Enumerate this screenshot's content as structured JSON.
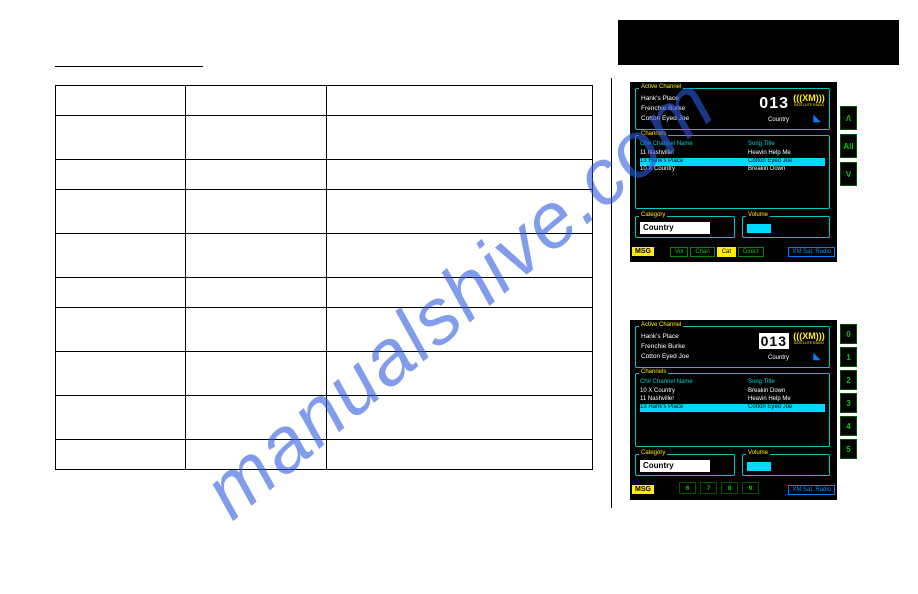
{
  "watermark": "manualshive.com",
  "fig1": {
    "active": {
      "label": "Active Channel",
      "name": "Hank's Place",
      "artist": "Frenchie Burke",
      "song": "Cotton Eyed Joe",
      "number": "013",
      "genre": "Country",
      "xm_mark": "(((XM)))",
      "xm_sub": "SATELLITE RADIO"
    },
    "channels": {
      "label": "Channels",
      "hdr_left": "Ch# Channel Name",
      "hdr_right": "Song Title",
      "rows": [
        {
          "n": "11  Nashville!",
          "t": "Heavin Help Me",
          "hl": false
        },
        {
          "n": "13  Hank's Place",
          "t": "Cotton Eyed Joe",
          "hl": true
        },
        {
          "n": "10  X Country",
          "t": "Breakin Down",
          "hl": false
        }
      ]
    },
    "category": {
      "label": "Category",
      "value": "Country"
    },
    "volume": {
      "label": "Volume"
    },
    "msg": "MSG",
    "buttons": [
      "Vol",
      "Chan",
      "Cat",
      "Direct"
    ],
    "active_btn": "Cat",
    "sat_radio": "XM Sat. Radio",
    "side": [
      "Ʌ",
      "All",
      "V"
    ]
  },
  "fig2": {
    "active": {
      "label": "Active Channel",
      "name": "Hank's Place",
      "artist": "Frenchie Burke",
      "song": "Cotton Eyed Joe",
      "number": "013",
      "genre": "Country",
      "xm_mark": "(((XM)))",
      "xm_sub": "SATELLITE RADIO"
    },
    "channels": {
      "label": "Channels",
      "hdr_left": "Ch# Channel Name",
      "hdr_right": "Song Title",
      "rows": [
        {
          "n": "10  X Country",
          "t": "Breakin Down",
          "hl": false
        },
        {
          "n": "11  Nashville!",
          "t": "Heavin Help Me",
          "hl": false
        },
        {
          "n": "13  Hank's Place",
          "t": "Cotton Eyed Joe",
          "hl": true
        }
      ]
    },
    "category": {
      "label": "Category",
      "value": "Country"
    },
    "volume": {
      "label": "Volume"
    },
    "msg": "MSG",
    "sat_radio": "XM Sat. Radio",
    "side": [
      "0",
      "1",
      "2",
      "3",
      "4",
      "5"
    ],
    "bottom": [
      "6",
      "7",
      "8",
      "9"
    ]
  }
}
